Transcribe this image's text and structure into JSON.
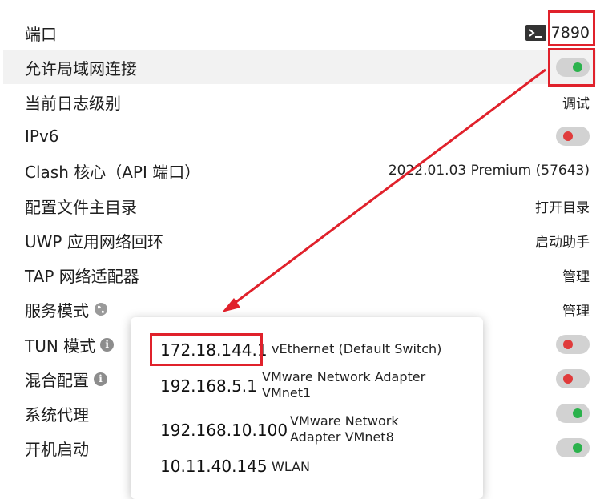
{
  "settings": {
    "port": {
      "label": "端口",
      "value": "7890"
    },
    "allow_lan": {
      "label": "允许局域网连接",
      "enabled": true
    },
    "log_level": {
      "label": "当前日志级别",
      "value": "调试"
    },
    "ipv6": {
      "label": "IPv6",
      "enabled": false
    },
    "core": {
      "label": "Clash 核心（API 端口）",
      "value": "2022.01.03 Premium (57643)"
    },
    "config_dir": {
      "label": "配置文件主目录",
      "value": "打开目录"
    },
    "uwp": {
      "label": "UWP 应用网络回环",
      "value": "启动助手"
    },
    "tap": {
      "label": "TAP 网络适配器",
      "value": "管理"
    },
    "service_mode": {
      "label": "服务模式",
      "value": "管理"
    },
    "tun_mode": {
      "label": "TUN 模式",
      "enabled": false
    },
    "mixin": {
      "label": "混合配置",
      "enabled": false
    },
    "system_proxy": {
      "label": "系统代理",
      "enabled": true
    },
    "autostart": {
      "label": "开机启动",
      "enabled": true
    }
  },
  "lan_popup": {
    "items": [
      {
        "ip": "172.18.144.1",
        "name": "vEthernet (Default Switch)"
      },
      {
        "ip": "192.168.5.1",
        "name": "VMware Network Adapter VMnet1"
      },
      {
        "ip": "192.168.10.100",
        "name": "VMware Network Adapter VMnet8"
      },
      {
        "ip": "10.11.40.145",
        "name": "WLAN"
      }
    ]
  },
  "colors": {
    "highlight": "#e0212b",
    "toggle_on": "#2bb24c",
    "toggle_off": "#e03b3b"
  },
  "icons": [
    "terminal-icon",
    "globe-icon",
    "info-icon"
  ]
}
